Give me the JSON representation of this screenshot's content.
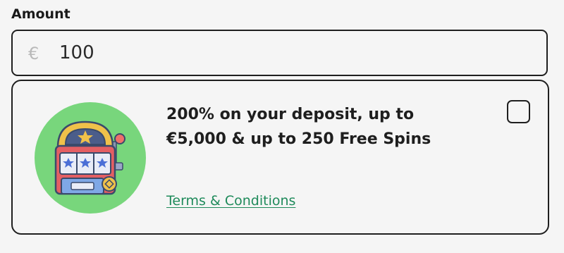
{
  "amount": {
    "label": "Amount",
    "currency_symbol": "€",
    "value": "100"
  },
  "bonus": {
    "title_line1": "200% on your deposit, up to",
    "title_line2": "€5,000 & up to 250 Free Spins",
    "terms_label": "Terms & Conditions",
    "selected": false,
    "icon": "slot-machine-icon"
  },
  "colors": {
    "background": "#f5f5f5",
    "border": "#1f1f1f",
    "link": "#1e8a5a",
    "icon_circle": "#78d67c"
  }
}
